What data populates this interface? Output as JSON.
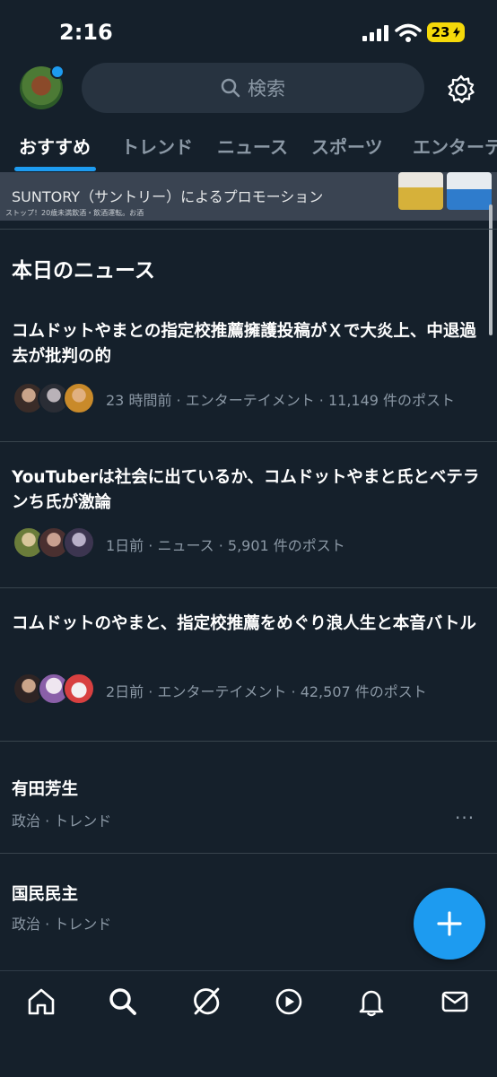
{
  "status_bar": {
    "time": "2:16",
    "battery": "23"
  },
  "header": {
    "search_placeholder": "検索"
  },
  "tabs": [
    {
      "label": "おすすめ",
      "active": true
    },
    {
      "label": "トレンド"
    },
    {
      "label": "ニュース"
    },
    {
      "label": "スポーツ"
    },
    {
      "label": "エンターテ"
    }
  ],
  "promo": {
    "title": "SUNTORY（サントリー）によるプロモーション",
    "disclaimer": "ストップ！20歳未満飲酒・飲酒運転。お酒"
  },
  "news_section": {
    "heading": "本日のニュース",
    "items": [
      {
        "title": "コムドットやまとの指定校推薦擁護投稿がＸで大炎上、中退過去が批判の的",
        "meta": "23 時間前 · エンターテイメント · 11,149 件のポスト"
      },
      {
        "title": "YouTuberは社会に出ているか、コムドットやまと氏とベテランち氏が激論",
        "meta": "1日前 · ニュース · 5,901 件のポスト"
      },
      {
        "title": "コムドットのやまと、指定校推薦をめぐり浪人生と本音バトル",
        "meta": "2日前 · エンターテイメント · 42,507 件のポスト"
      }
    ]
  },
  "trends": [
    {
      "title": "有田芳生",
      "meta": "政治 · トレンド",
      "more": "···"
    },
    {
      "title": "国民民主",
      "meta": "政治 · トレンド"
    }
  ],
  "colors": {
    "background": "#15202b",
    "accent": "#1d9bf0",
    "secondary_text": "#8b98a5",
    "battery": "#f5d90a"
  },
  "icons": {
    "nav": [
      "home-icon",
      "search-icon",
      "grok-icon",
      "video-icon",
      "bell-icon",
      "mail-icon"
    ],
    "fab": "plus-icon",
    "settings": "gear-icon"
  }
}
